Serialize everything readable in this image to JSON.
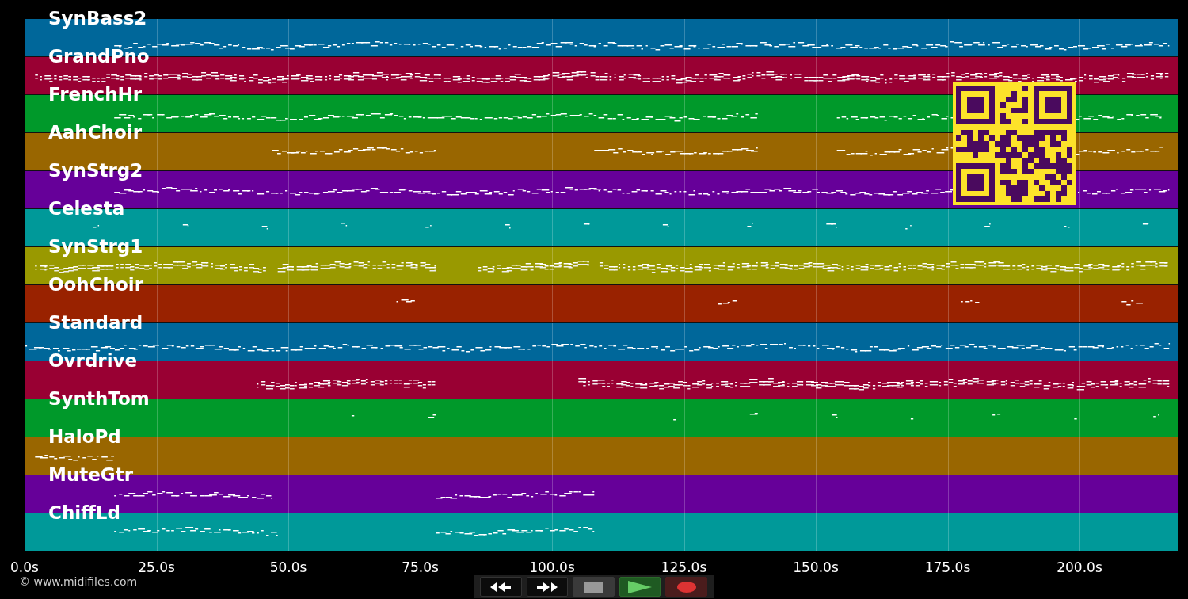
{
  "tracks": [
    {
      "name": "SynBass2",
      "color": "#00679a"
    },
    {
      "name": "GrandPno",
      "color": "#990033"
    },
    {
      "name": "FrenchHr",
      "color": "#00992a"
    },
    {
      "name": "AahChoir",
      "color": "#996600"
    },
    {
      "name": "SynStrg2",
      "color": "#660099"
    },
    {
      "name": "Celesta",
      "color": "#009999"
    },
    {
      "name": "SynStrg1",
      "color": "#999900"
    },
    {
      "name": "OohChoir",
      "color": "#992200"
    },
    {
      "name": "Standard",
      "color": "#00679a"
    },
    {
      "name": "Ovrdrive",
      "color": "#990033"
    },
    {
      "name": "SynthTom",
      "color": "#00992a"
    },
    {
      "name": "HaloPd",
      "color": "#996600"
    },
    {
      "name": "MuteGtr",
      "color": "#660099"
    },
    {
      "name": "ChiffLd",
      "color": "#009999"
    }
  ],
  "time_axis": {
    "ticks": [
      "0.0s",
      "25.0s",
      "50.0s",
      "75.0s",
      "100.0s",
      "125.0s",
      "150.0s",
      "175.0s",
      "200.0s"
    ]
  },
  "transport": [
    {
      "kind": "rewind"
    },
    {
      "kind": "forward"
    },
    {
      "kind": "stop"
    },
    {
      "kind": "play"
    },
    {
      "kind": "record"
    }
  ],
  "copyright": "© www.midifiles.com"
}
